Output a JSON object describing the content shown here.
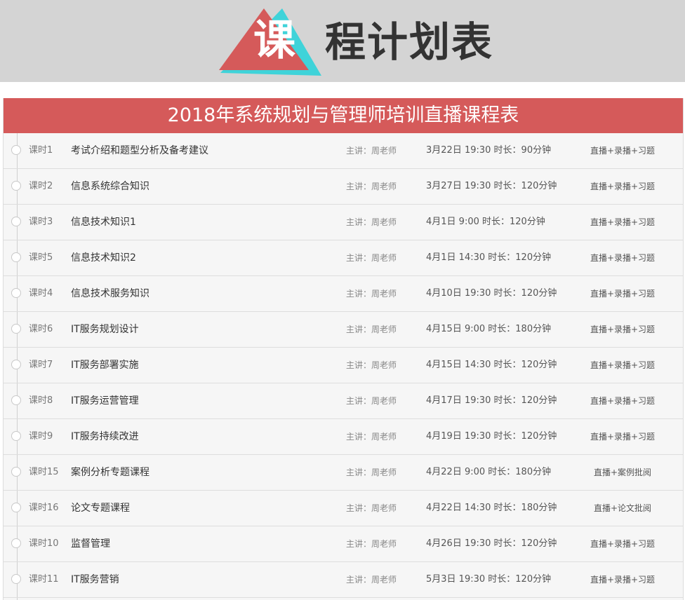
{
  "banner": {
    "logo_char": "课",
    "title": "程计划表"
  },
  "colors": {
    "accent_red": "#d55a5a",
    "accent_cyan": "#3fd3d9",
    "banner_bg": "#d4d4d4"
  },
  "table": {
    "header": "2018年系统规划与管理师培训直播课程表",
    "rows": [
      {
        "lesson": "课时1",
        "title": "考试介绍和题型分析及备考建议",
        "teacher": "主讲：周老师",
        "time": "3月22日 19:30 时长：90分钟",
        "type": "直播+录播+习题"
      },
      {
        "lesson": "课时2",
        "title": "信息系统综合知识",
        "teacher": "主讲：周老师",
        "time": "3月27日 19:30 时长：120分钟",
        "type": "直播+录播+习题"
      },
      {
        "lesson": "课时3",
        "title": "信息技术知识1",
        "teacher": "主讲：周老师",
        "time": "4月1日 9:00 时长：120分钟",
        "type": "直播+录播+习题"
      },
      {
        "lesson": "课时5",
        "title": "信息技术知识2",
        "teacher": "主讲：周老师",
        "time": "4月1日 14:30 时长：120分钟",
        "type": "直播+录播+习题"
      },
      {
        "lesson": "课时4",
        "title": "信息技术服务知识",
        "teacher": "主讲：周老师",
        "time": "4月10日 19:30 时长：120分钟",
        "type": "直播+录播+习题"
      },
      {
        "lesson": "课时6",
        "title": "IT服务规划设计",
        "teacher": "主讲：周老师",
        "time": "4月15日 9:00 时长：180分钟",
        "type": "直播+录播+习题"
      },
      {
        "lesson": "课时7",
        "title": "IT服务部署实施",
        "teacher": "主讲：周老师",
        "time": "4月15日 14:30 时长：120分钟",
        "type": "直播+录播+习题"
      },
      {
        "lesson": "课时8",
        "title": "IT服务运营管理",
        "teacher": "主讲：周老师",
        "time": "4月17日 19:30 时长：120分钟",
        "type": "直播+录播+习题"
      },
      {
        "lesson": "课时9",
        "title": "IT服务持续改进",
        "teacher": "主讲：周老师",
        "time": "4月19日 19:30 时长：120分钟",
        "type": "直播+录播+习题"
      },
      {
        "lesson": "课时15",
        "title": "案例分析专题课程",
        "teacher": "主讲：周老师",
        "time": "4月22日 9:00 时长：180分钟",
        "type": "直播+案例批阅"
      },
      {
        "lesson": "课时16",
        "title": "论文专题课程",
        "teacher": "主讲：周老师",
        "time": "4月22日 14:30 时长：180分钟",
        "type": "直播+论文批阅"
      },
      {
        "lesson": "课时10",
        "title": "监督管理",
        "teacher": "主讲：周老师",
        "time": "4月26日 19:30 时长：120分钟",
        "type": "直播+录播+习题"
      },
      {
        "lesson": "课时11",
        "title": "IT服务营销",
        "teacher": "主讲：周老师",
        "time": "5月3日 19:30 时长：120分钟",
        "type": "直播+录播+习题"
      }
    ]
  }
}
